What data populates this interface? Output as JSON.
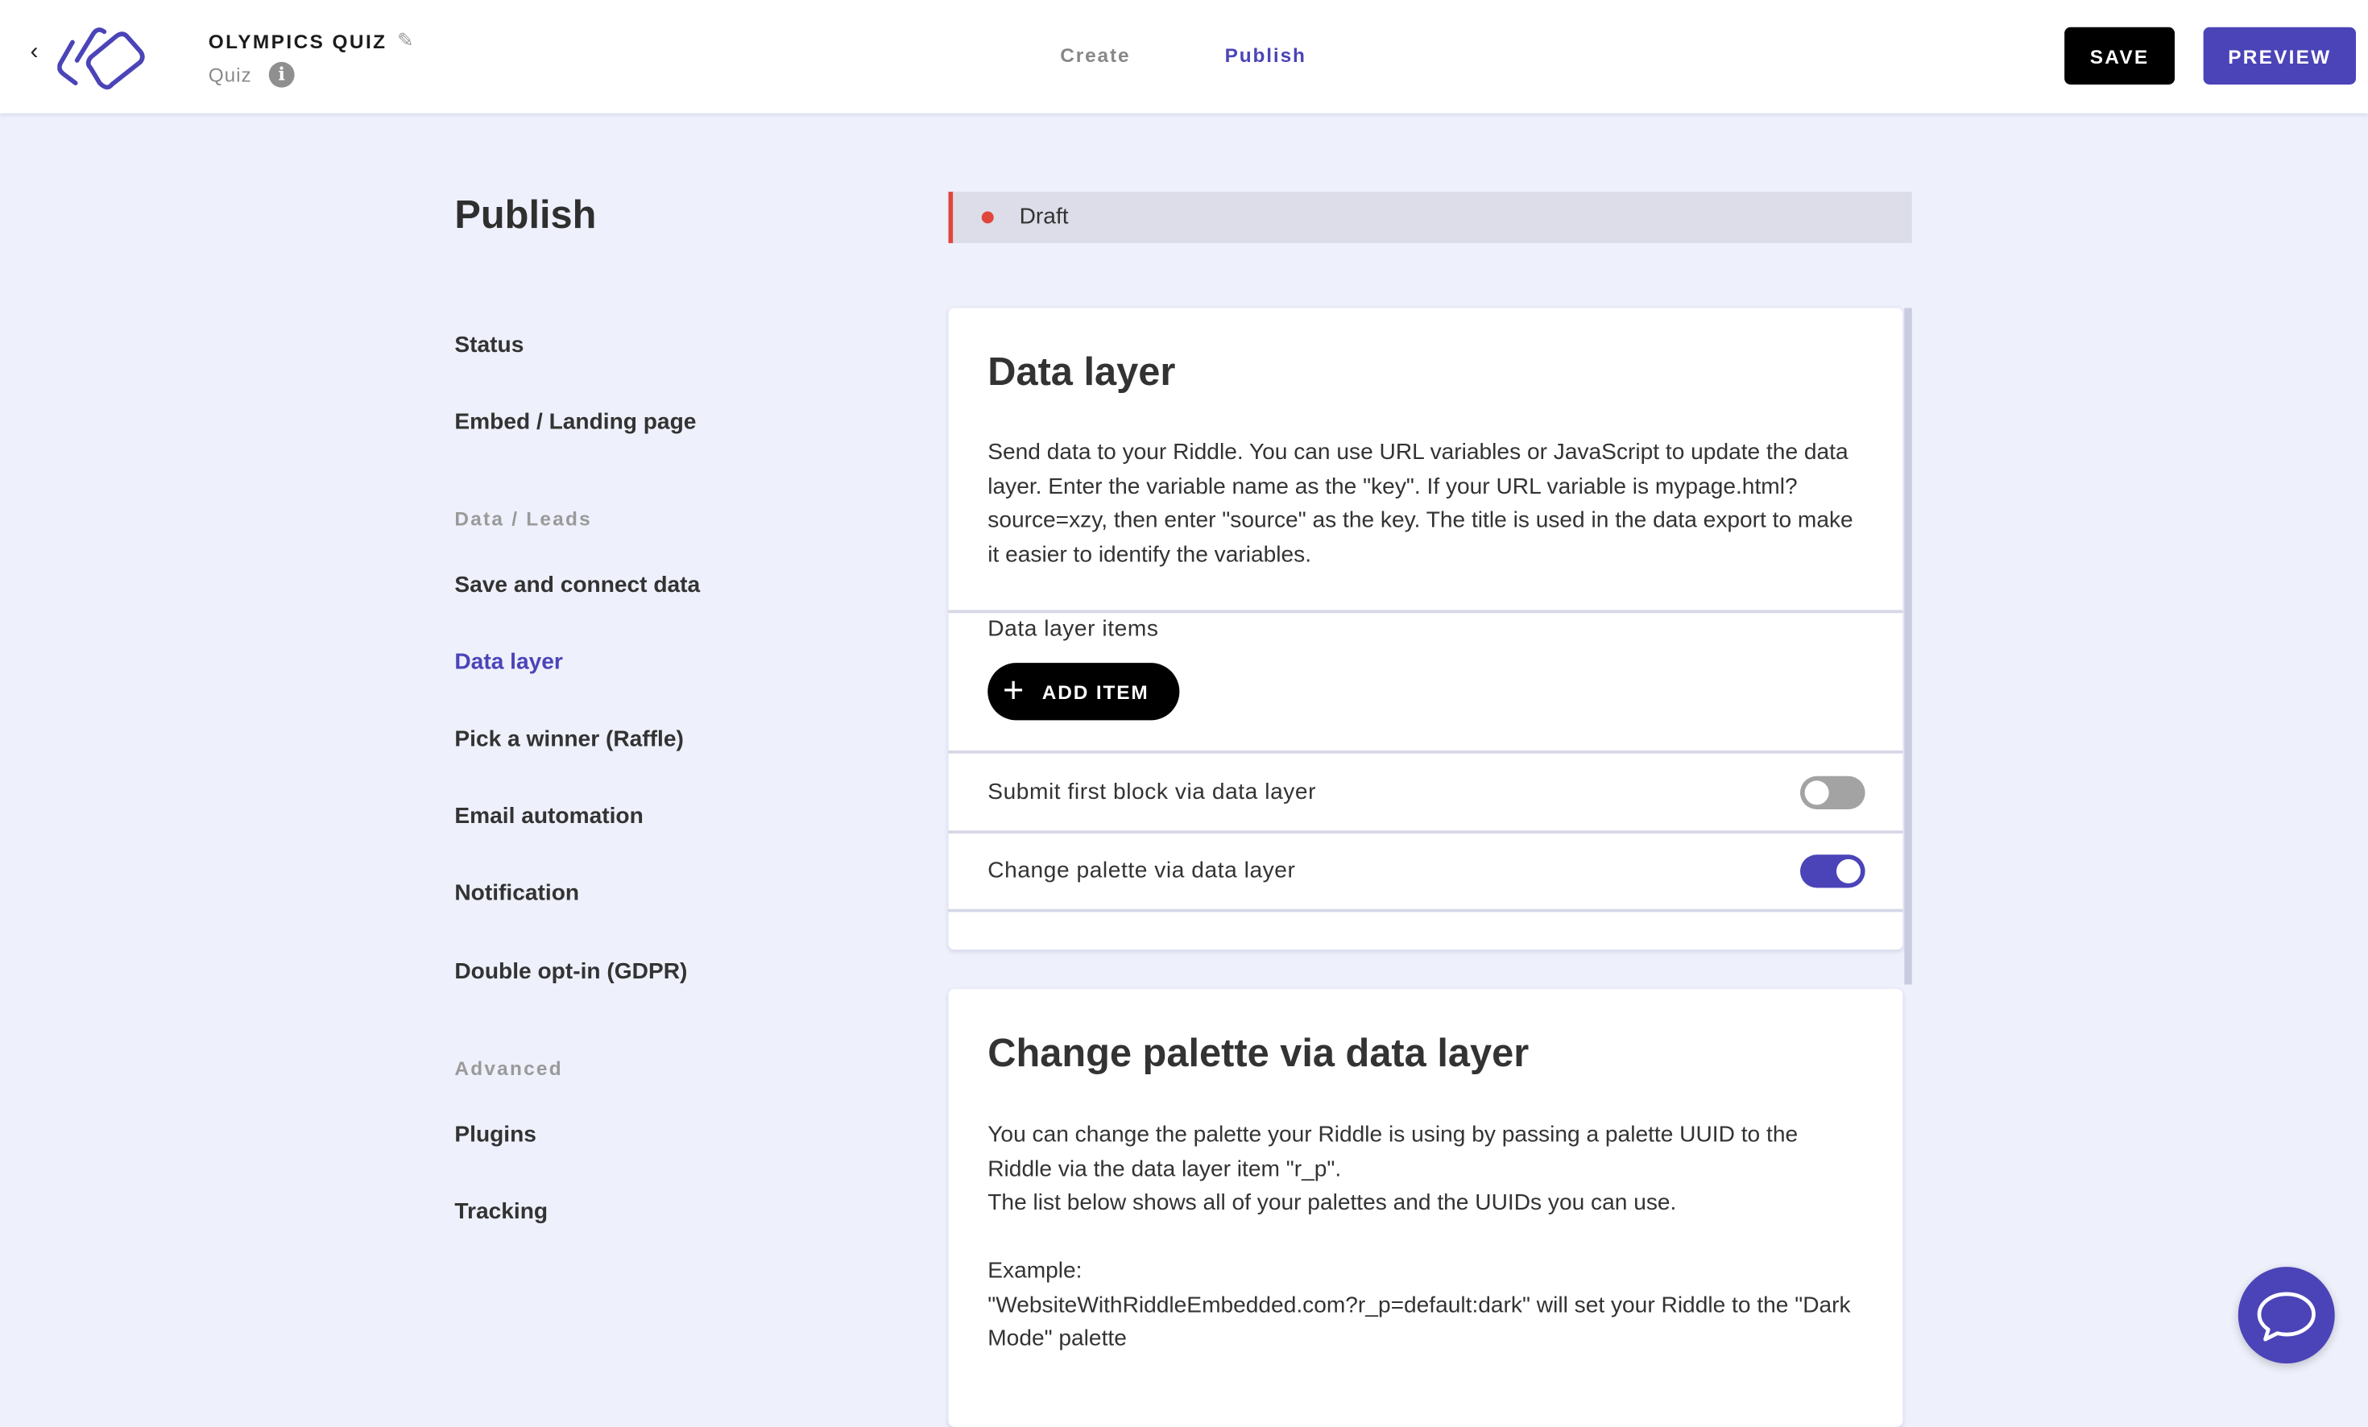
{
  "header": {
    "title": "OLYMPICS QUIZ",
    "subtitle": "Quiz",
    "tabs": [
      {
        "label": "Create",
        "active": false
      },
      {
        "label": "Publish",
        "active": true
      }
    ],
    "save_label": "SAVE",
    "preview_label": "PREVIEW"
  },
  "colors": {
    "accent": "#4b44b8",
    "draft": "#e0463c",
    "background": "#eef0fb"
  },
  "page_title": "Publish",
  "sidebar": {
    "items": [
      {
        "label": "Status"
      },
      {
        "label": "Embed / Landing page"
      },
      {
        "group": "Data / Leads"
      },
      {
        "label": "Save and connect data"
      },
      {
        "label": "Data layer",
        "active": true
      },
      {
        "label": "Pick a winner (Raffle)"
      },
      {
        "label": "Email automation"
      },
      {
        "label": "Notification"
      },
      {
        "label": "Double opt-in (GDPR)"
      },
      {
        "group": "Advanced"
      },
      {
        "label": "Plugins"
      },
      {
        "label": "Tracking"
      }
    ]
  },
  "status": {
    "label": "Draft"
  },
  "data_layer": {
    "title": "Data layer",
    "description": "Send data to your Riddle. You can use URL variables or JavaScript to update the data layer. Enter the variable name as the \"key\". If your URL variable is mypage.html?source=xzy, then enter \"source\" as the key. The title is used in the data export to make it easier to identify the variables.",
    "items_label": "Data layer items",
    "add_item_label": "ADD ITEM",
    "toggles": [
      {
        "label": "Submit first block via data layer",
        "on": false
      },
      {
        "label": "Change palette via data layer",
        "on": true
      }
    ]
  },
  "palette": {
    "title": "Change palette via data layer",
    "lines": [
      "You can change the palette your Riddle is using by passing a palette UUID to the Riddle via the data layer item \"r_p\".",
      "The list below shows all of your palettes and the UUIDs you can use.",
      "",
      "Example:",
      "\"WebsiteWithRiddleEmbedded.com?r_p=default:dark\" will set your Riddle to the \"Dark Mode\" palette"
    ]
  }
}
